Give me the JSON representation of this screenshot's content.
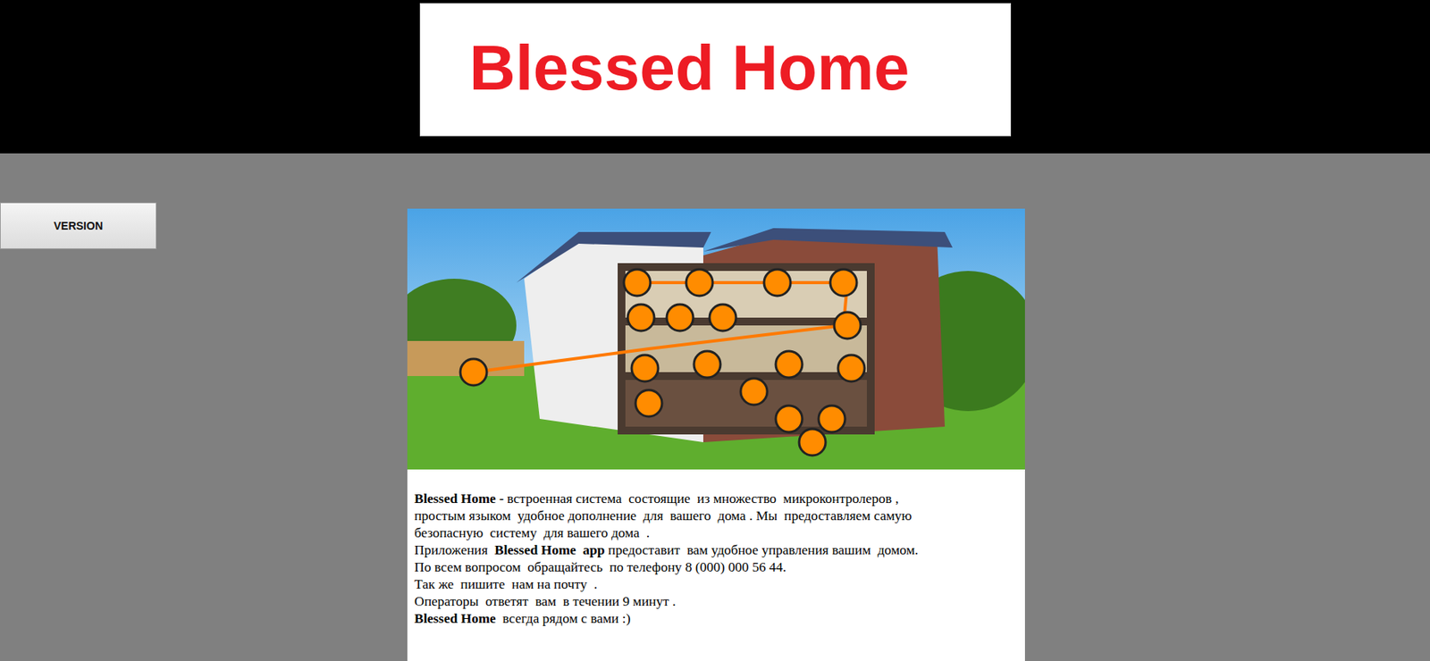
{
  "header": {
    "logo": "Blessed Home"
  },
  "sidebar": {
    "buttons": [
      {
        "label": "VERSION"
      }
    ]
  },
  "content": {
    "lines": [
      [
        {
          "text": "Blessed Home -",
          "bold": true
        },
        {
          "text": " встроенная система  состоящие  из множество  микроконтролеров ,",
          "bold": false
        }
      ],
      [
        {
          "text": "простым языком  удобное дополнение  для  вашего  дома . Мы  предоставляем самую",
          "bold": false
        }
      ],
      [
        {
          "text": "безопасную  систему  для вашего дома  .",
          "bold": false
        }
      ],
      [
        {
          "text": "Приложения  ",
          "bold": false
        },
        {
          "text": "Blessed Home  app",
          "bold": true
        },
        {
          "text": " предоставит  вам удобное управления вашим  домом.",
          "bold": false
        }
      ],
      [
        {
          "text": "По всем вопросом  обращайтесь  по телефону 8 (000) 000 56 44.",
          "bold": false
        }
      ],
      [
        {
          "text": "Так же  пишите  нам на почту  .",
          "bold": false
        }
      ],
      [
        {
          "text": "Операторы  ответят  вам  в течении 9 минут .",
          "bold": false
        }
      ],
      [
        {
          "text": "Blessed Home",
          "bold": true
        },
        {
          "text": "  всегда рядом с вами :)",
          "bold": false
        }
      ]
    ]
  }
}
